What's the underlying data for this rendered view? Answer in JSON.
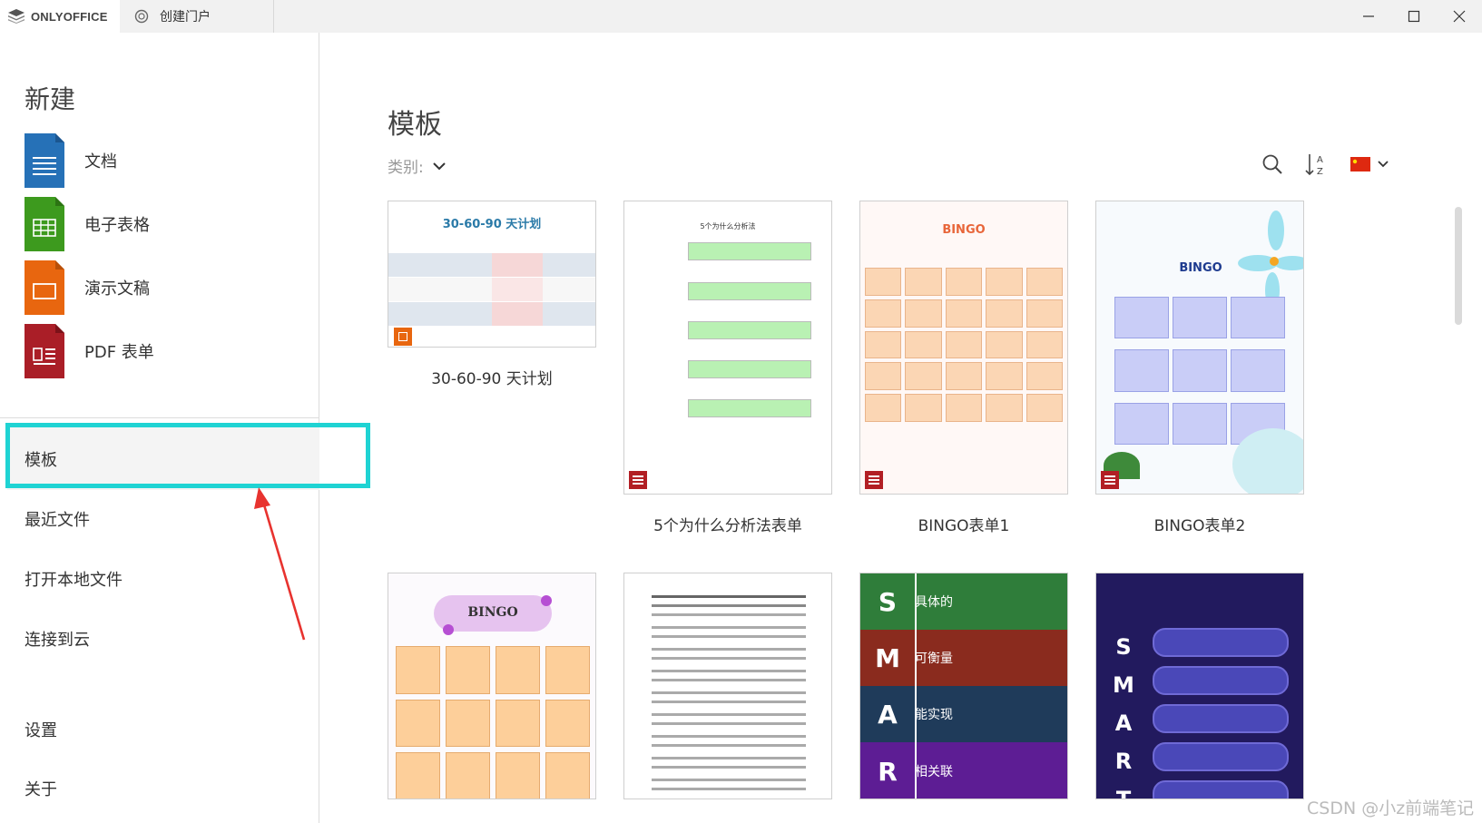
{
  "titlebar": {
    "app_name": "ONLYOFFICE",
    "portal_tab": "创建门户",
    "icons": [
      "onlyoffice-logo-icon",
      "portal-icon",
      "minimize-icon",
      "maximize-icon",
      "close-icon"
    ]
  },
  "sidebar": {
    "new_title": "新建",
    "new_items": [
      {
        "label": "文档",
        "icon": "document-icon",
        "color": "#2671b7"
      },
      {
        "label": "电子表格",
        "icon": "spreadsheet-icon",
        "color": "#3d9a1e"
      },
      {
        "label": "演示文稿",
        "icon": "presentation-icon",
        "color": "#e8660f"
      },
      {
        "label": "PDF 表单",
        "icon": "pdf-form-icon",
        "color": "#aa1e27"
      }
    ],
    "nav": {
      "templates": "模板",
      "recent": "最近文件",
      "open_local": "打开本地文件",
      "connect_cloud": "连接到云",
      "settings": "设置",
      "about": "关于"
    }
  },
  "main": {
    "title": "模板",
    "category_label": "类别:",
    "templates": [
      {
        "title": "30-60-90 天计划",
        "thumb_heading": "30-60-90 天计划"
      },
      {
        "title": "5个为什么分析法表单",
        "thumb_heading": "5个为什么分析法"
      },
      {
        "title": "BINGO表单1",
        "thumb_heading": "BINGO"
      },
      {
        "title": "BINGO表单2",
        "thumb_heading": "BINGO"
      }
    ],
    "row2": {
      "bingo_heading": "BINGO",
      "smart": [
        {
          "letter": "S",
          "text": "具体的"
        },
        {
          "letter": "M",
          "text": "可衡量"
        },
        {
          "letter": "A",
          "text": "能实现"
        },
        {
          "letter": "R",
          "text": "相关联"
        }
      ],
      "smart_dark_letters": [
        "S",
        "M",
        "A",
        "R",
        "T"
      ]
    }
  },
  "watermark": "CSDN @小z前端笔记"
}
